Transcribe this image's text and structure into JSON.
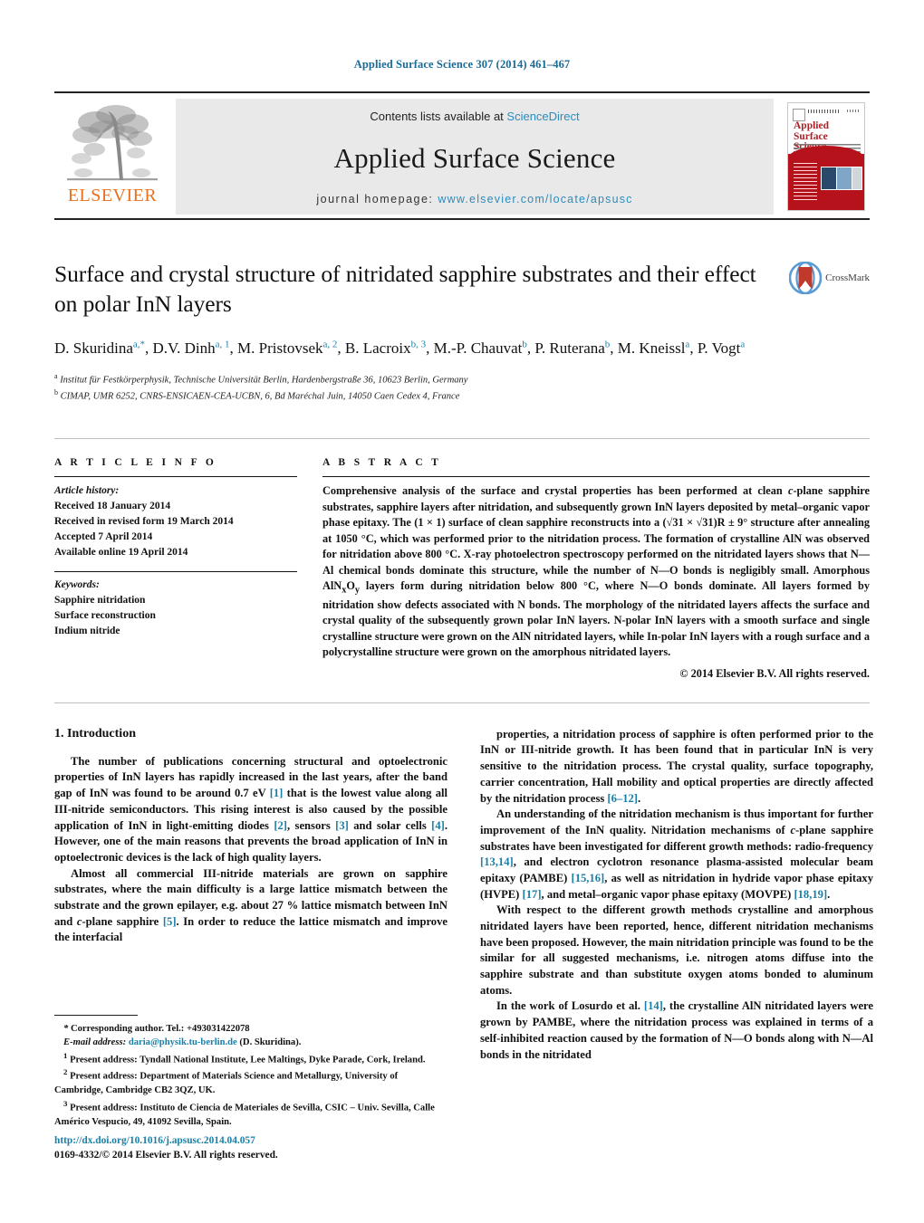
{
  "running_head": "Applied Surface Science 307 (2014) 461–467",
  "banner": {
    "publisher": "ELSEVIER",
    "contents_prefix": "Contents lists available at ",
    "contents_link": "ScienceDirect",
    "journal_name": "Applied Surface Science",
    "homepage_prefix": "journal homepage: ",
    "homepage_url": "www.elsevier.com/locate/apsusc",
    "cover_title_line1": "Applied",
    "cover_title_line2": "Surface Science"
  },
  "crossmark": {
    "label": "CrossMark"
  },
  "title": "Surface and crystal structure of nitridated sapphire substrates and their effect on polar InN layers",
  "authors_html": "D. Skuridina<sup>a,*</sup>, D.V. Dinh<sup>a, 1</sup>, M. Pristovsek<sup>a, 2</sup>, B. Lacroix<sup>b, 3</sup>, M.-P. Chauvat<sup>b</sup>, P. Ruterana<sup>b</sup>, M. Kneissl<sup>a</sup>, P. Vogt<sup>a</sup>",
  "affiliations": [
    {
      "mark": "a",
      "text": "Institut für Festkörperphysik, Technische Universität Berlin, Hardenbergstraße 36, 10623 Berlin, Germany"
    },
    {
      "mark": "b",
      "text": "CIMAP, UMR 6252, CNRS-ENSICAEN-CEA-UCBN, 6, Bd Maréchal Juin, 14050 Caen Cedex 4, France"
    }
  ],
  "article_info": {
    "heading": "A R T I C L E    I N F O",
    "history_label": "Article history:",
    "history": [
      "Received 18 January 2014",
      "Received in revised form 19 March 2014",
      "Accepted 7 April 2014",
      "Available online 19 April 2014"
    ],
    "keywords_label": "Keywords:",
    "keywords": [
      "Sapphire nitridation",
      "Surface reconstruction",
      "Indium nitride"
    ]
  },
  "abstract": {
    "heading": "A B S T R A C T",
    "text_html": "Comprehensive analysis of the surface and crystal properties has been performed at clean <i>c</i>-plane sapphire substrates, sapphire layers after nitridation, and subsequently grown InN layers deposited by metal–organic vapor phase epitaxy. The (1 × 1) surface of clean sapphire reconstructs into a (&#8730;31 × &#8730;31)R ± 9° structure after annealing at 1050 °C, which was performed prior to the nitridation process. The formation of crystalline AlN was observed for nitridation above 800 °C. X-ray photoelectron spectroscopy performed on the nitridated layers shows that N—Al chemical bonds dominate this structure, while the number of N—O bonds is negligibly small. Amorphous AlN<sub>x</sub>O<sub>y</sub> layers form during nitridation below 800 °C, where N—O bonds dominate. All layers formed by nitridation show defects associated with N bonds. The morphology of the nitridated layers affects the surface and crystal quality of the subsequently grown polar InN layers. N-polar InN layers with a smooth surface and single crystalline structure were grown on the AlN nitridated layers, while In-polar InN layers with a rough surface and a polycrystalline structure were grown on the amorphous nitridated layers.",
    "copyright": "© 2014 Elsevier B.V. All rights reserved."
  },
  "body": {
    "section_title": "1.  Introduction",
    "left_paragraphs_html": [
      "The number of publications concerning structural and optoelectronic properties of InN layers has rapidly increased in the last years, after the band gap of InN was found to be around 0.7 eV <span class=\"ref\">[1]</span> that is the lowest value along all III-nitride semiconductors. This rising interest is also caused by the possible application of InN in light-emitting diodes <span class=\"ref\">[2]</span>, sensors <span class=\"ref\">[3]</span> and solar cells <span class=\"ref\">[4]</span>. However, one of the main reasons that prevents the broad application of InN in optoelectronic devices is the lack of high quality layers.",
      "Almost all commercial III-nitride materials are grown on sapphire substrates, where the main difficulty is a large lattice mismatch between the substrate and the grown epilayer, e.g. about 27 % lattice mismatch between InN and <span class=\"ital\">c</span>-plane sapphire <span class=\"ref\">[5]</span>. In order to reduce the lattice mismatch and improve the interfacial"
    ],
    "right_paragraphs_html": [
      "properties, a nitridation process of sapphire is often performed prior to the InN or III-nitride growth. It has been found that in particular InN is very sensitive to the nitridation process. The crystal quality, surface topography, carrier concentration, Hall mobility and optical properties are directly affected by the nitridation process <span class=\"ref\">[6–12]</span>.",
      "An understanding of the nitridation mechanism is thus important for further improvement of the InN quality. Nitridation mechanisms of <span class=\"ital\">c</span>-plane sapphire substrates have been investigated for different growth methods: radio-frequency <span class=\"ref\">[13,14]</span>, and electron cyclotron resonance plasma-assisted molecular beam epitaxy (PAMBE) <span class=\"ref\">[15,16]</span>, as well as nitridation in hydride vapor phase epitaxy (HVPE) <span class=\"ref\">[17]</span>, and metal–organic vapor phase epitaxy (MOVPE) <span class=\"ref\">[18,19]</span>.",
      "With respect to the different growth methods crystalline and amorphous nitridated layers have been reported, hence, different nitridation mechanisms have been proposed. However, the main nitridation principle was found to be the similar for all suggested mechanisms, i.e. nitrogen atoms diffuse into the sapphire substrate and than substitute oxygen atoms bonded to aluminum atoms.",
      "In the work of Losurdo et al. <span class=\"ref\">[14]</span>, the crystalline AlN nitridated layers were grown by PAMBE, where the nitridation process was explained in terms of a self-inhibited reaction caused by the formation of N—O bonds along with N—Al bonds in the nitridated"
    ]
  },
  "footnotes_html": [
    "<span class=\"lbl\">*</span> Corresponding author. Tel.: +493031422078",
    "<span class=\"lbl\">E-mail address:</span> <span class=\"link\">daria@physik.tu-berlin.de</span> (D. Skuridina).",
    "<sup>1</sup> Present address: Tyndall National Institute, Lee Maltings, Dyke Parade, Cork, Ireland.",
    "<sup>2</sup> Present address: Department of Materials Science and Metallurgy, University of Cambridge, Cambridge CB2 3QZ, UK.",
    "<sup>3</sup> Present address: Instituto de Ciencia de Materiales de Sevilla, CSIC – Univ. Sevilla, Calle Américo Vespucio, 49, 41092 Sevilla, Spain."
  ],
  "footer": {
    "doi": "http://dx.doi.org/10.1016/j.apsusc.2014.04.057",
    "issn": "0169-4332/© 2014 Elsevier B.V. All rights reserved."
  },
  "colors": {
    "link": "#1a7fa8",
    "banner_link": "#2b8cbe",
    "elsevier_orange": "#E9711C",
    "cover_red": "#b5121b"
  }
}
